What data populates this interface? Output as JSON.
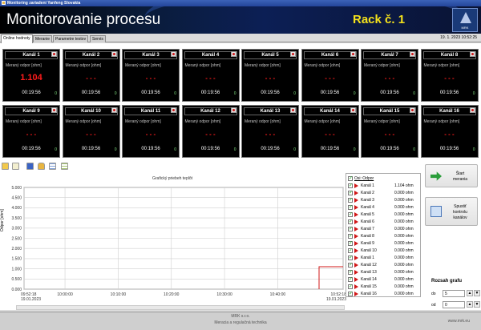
{
  "window": {
    "title": "Monitoring zariadení Yanfeng Slovakia"
  },
  "banner": {
    "title": "Monitorovanie procesu",
    "rack": "Rack č. 1",
    "logo_text": "MRK",
    "logo_sub": "MERACIA A REGULAČNÁ TECHNIKA"
  },
  "tabs": [
    "Online hodnoty",
    "Meranie",
    "Parametre testov",
    "Servis"
  ],
  "datetime": "19. 1. 2023 10:52:25",
  "channel_label": "Meraný odpor [ohm]",
  "channels": [
    {
      "name": "Kanál 1",
      "value": "1.104",
      "time": "00:19:56",
      "count": "0"
    },
    {
      "name": "Kanál 2",
      "value": "- - -",
      "time": "00:19:56",
      "count": "0"
    },
    {
      "name": "Kanál 3",
      "value": "- - -",
      "time": "00:19:56",
      "count": "0"
    },
    {
      "name": "Kanál 4",
      "value": "- - -",
      "time": "00:19:56",
      "count": "0"
    },
    {
      "name": "Kanál 5",
      "value": "- - -",
      "time": "00:19:56",
      "count": "0"
    },
    {
      "name": "Kanál 6",
      "value": "- - -",
      "time": "00:19:56",
      "count": "0"
    },
    {
      "name": "Kanál 7",
      "value": "- - -",
      "time": "00:19:56",
      "count": "0"
    },
    {
      "name": "Kanál 8",
      "value": "- - -",
      "time": "00:19:56",
      "count": "0"
    },
    {
      "name": "Kanál 9",
      "value": "- - -",
      "time": "00:19:56",
      "count": "0"
    },
    {
      "name": "Kanál 10",
      "value": "- - -",
      "time": "00:19:56",
      "count": "0"
    },
    {
      "name": "Kanál 11",
      "value": "- - -",
      "time": "00:19:56",
      "count": "0"
    },
    {
      "name": "Kanál 12",
      "value": "- - -",
      "time": "00:19:56",
      "count": "0"
    },
    {
      "name": "Kanál 13",
      "value": "- - -",
      "time": "00:19:56",
      "count": "0"
    },
    {
      "name": "Kanál 14",
      "value": "- - -",
      "time": "00:19:56",
      "count": "0"
    },
    {
      "name": "Kanál 15",
      "value": "- - -",
      "time": "00:19:56",
      "count": "0"
    },
    {
      "name": "Kanál 16",
      "value": "- - -",
      "time": "00:19:56",
      "count": "0"
    }
  ],
  "toolbar_icons": [
    "folder-icon",
    "notes-icon",
    "save-icon",
    "lock-icon",
    "grid-icon",
    "list-icon"
  ],
  "chart_data": {
    "type": "line",
    "title": "Grafický priebeh teplôt",
    "ylabel": "Odpor [ohm]",
    "ylim": [
      0,
      5
    ],
    "yticks": [
      "5.000",
      "4.500",
      "4.000",
      "3.500",
      "3.000",
      "2.500",
      "2.000",
      "1.500",
      "1.000",
      "0.500",
      "0.000"
    ],
    "xticks": [
      {
        "time": "09:52:18",
        "date": "19.01.2023"
      },
      {
        "time": "10:00:00",
        "date": ""
      },
      {
        "time": "10:10:00",
        "date": ""
      },
      {
        "time": "10:20:00",
        "date": ""
      },
      {
        "time": "10:30:00",
        "date": ""
      },
      {
        "time": "10:40:00",
        "date": ""
      },
      {
        "time": "10:52:18",
        "date": "19.01.2023"
      }
    ],
    "series": [
      {
        "name": "Kanál 1",
        "color": "#d01818",
        "points": [
          {
            "x": "10:52:18",
            "y": 0
          },
          {
            "x": "10:52:18",
            "y": 1.104
          }
        ]
      }
    ],
    "grid": true
  },
  "legend": {
    "header": {
      "name": "Osi: Odpor"
    },
    "rows": [
      {
        "name": "Kanál 1",
        "value": "1.104 ohm"
      },
      {
        "name": "Kanál 2",
        "value": "0.000 ohm"
      },
      {
        "name": "Kanál 3",
        "value": "0.000 ohm"
      },
      {
        "name": "Kanál 4",
        "value": "0.000 ohm"
      },
      {
        "name": "Kanál 5",
        "value": "0.000 ohm"
      },
      {
        "name": "Kanál 6",
        "value": "0.000 ohm"
      },
      {
        "name": "Kanál 7",
        "value": "0.000 ohm"
      },
      {
        "name": "Kanál 8",
        "value": "0.000 ohm"
      },
      {
        "name": "Kanál 9",
        "value": "0.000 ohm"
      },
      {
        "name": "Kanál 10",
        "value": "0.000 ohm"
      },
      {
        "name": "Kanál 1",
        "value": "0.000 ohm"
      },
      {
        "name": "Kanál 12",
        "value": "0.000 ohm"
      },
      {
        "name": "Kanál 13",
        "value": "0.000 ohm"
      },
      {
        "name": "Kanál 14",
        "value": "0.000 ohm"
      },
      {
        "name": "Kanál 15",
        "value": "0.000 ohm"
      },
      {
        "name": "Kanál 16",
        "value": "0.000 ohm"
      }
    ]
  },
  "buttons": {
    "start": {
      "line1": "Štart",
      "line2": "merania"
    },
    "check": {
      "line1": "Spustiť",
      "line2": "kontrolu",
      "line3": "kanálov"
    }
  },
  "range": {
    "title": "Rozsah grafu",
    "do_label": "do",
    "do_value": "5",
    "od_label": "od",
    "od_value": "0"
  },
  "footer": {
    "company": "MRK s.r.o.",
    "tagline": "Meracia a regulačná technika",
    "url": "www.mrk.eu"
  }
}
